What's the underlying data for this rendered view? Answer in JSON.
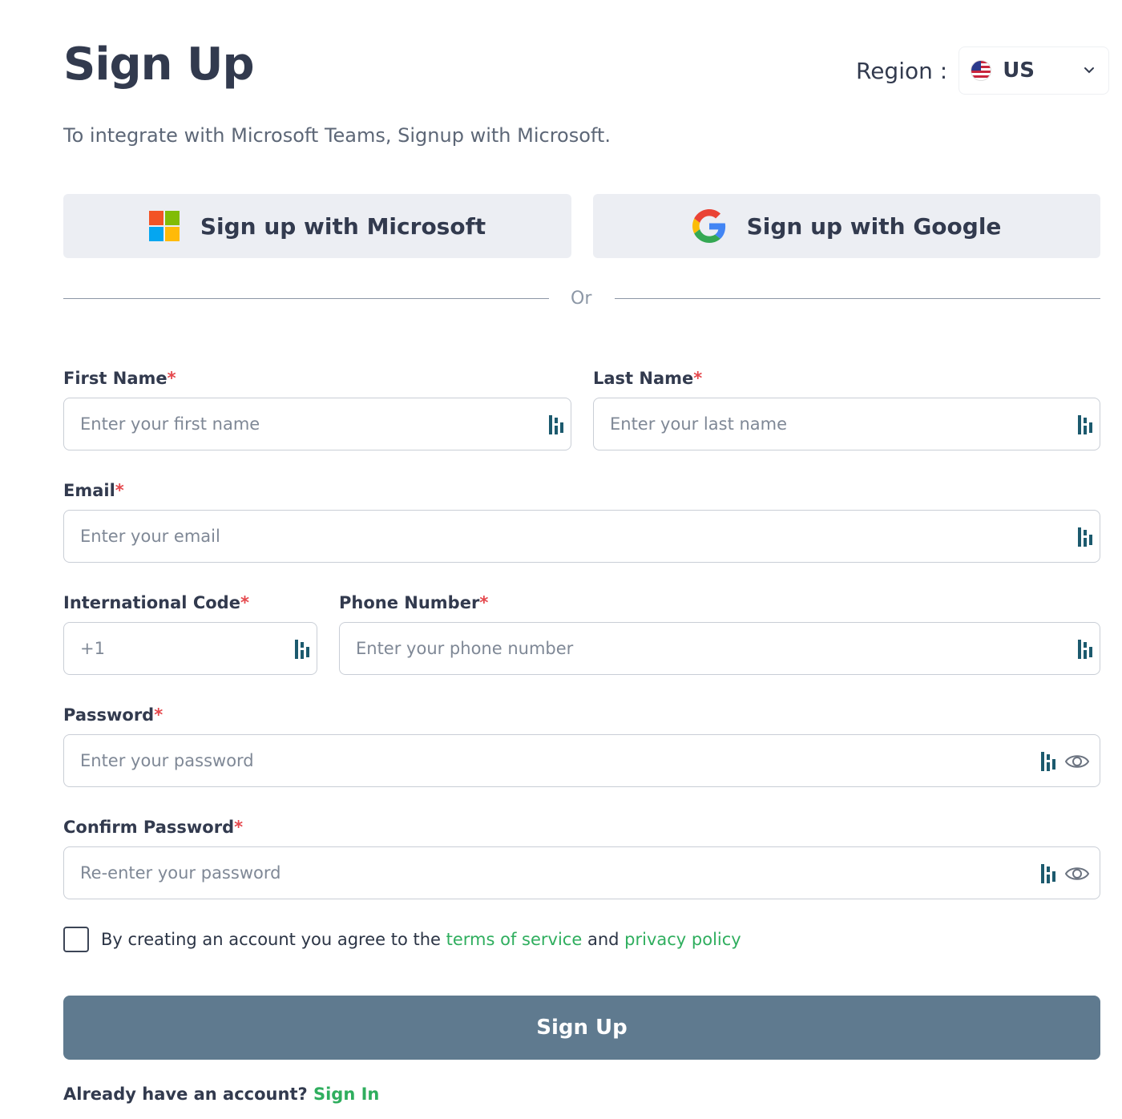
{
  "header": {
    "title": "Sign Up",
    "region_label": "Region :",
    "region_value": "US"
  },
  "subtitle": "To integrate with Microsoft Teams, Signup with Microsoft.",
  "oauth": {
    "microsoft_label": "Sign up with Microsoft",
    "google_label": "Sign up with Google"
  },
  "divider": "Or",
  "form": {
    "first_name": {
      "label": "First Name",
      "placeholder": "Enter your first name"
    },
    "last_name": {
      "label": "Last Name",
      "placeholder": "Enter your last name"
    },
    "email": {
      "label": "Email",
      "placeholder": "Enter your email"
    },
    "intl_code": {
      "label": "International Code",
      "value": "+1"
    },
    "phone": {
      "label": "Phone Number",
      "placeholder": "Enter your phone number"
    },
    "password": {
      "label": "Password",
      "placeholder": "Enter your password"
    },
    "confirm_password": {
      "label": "Confirm Password",
      "placeholder": "Re-enter your password"
    },
    "required_mark": "*"
  },
  "terms": {
    "prefix": "By creating an account you agree to the ",
    "tos": "terms of service",
    "and": " and ",
    "privacy": "privacy policy"
  },
  "submit_label": "Sign Up",
  "signin": {
    "prompt": "Already have an account? ",
    "link": "Sign In"
  },
  "colors": {
    "accent_green": "#2fae5e",
    "submit_bg": "#5f7a8f",
    "required": "#e5484d"
  }
}
